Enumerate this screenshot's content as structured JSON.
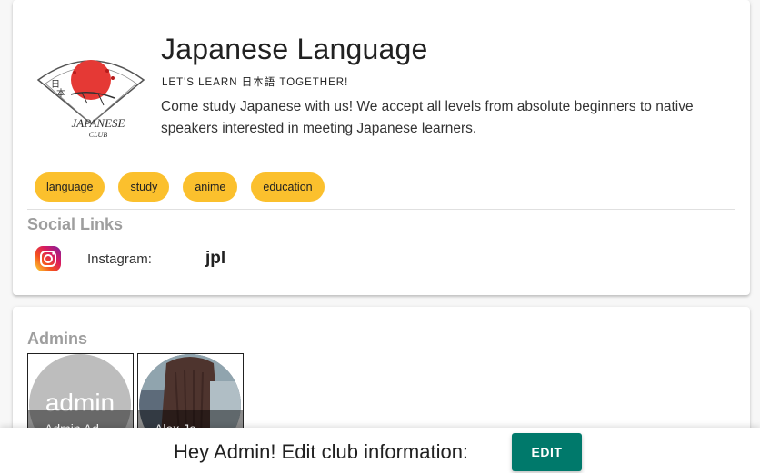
{
  "club": {
    "name": "Japanese Language",
    "tagline": "LET'S LEARN 日本語 TOGETHER!",
    "description": "Come study Japanese with us! We accept all levels from absolute beginners to native speakers interested in meeting Japanese learners.",
    "logo": {
      "icon": "japanese-club-fan-logo",
      "text_line1": "JAPANESE",
      "text_line2": "CLUB",
      "kanji": [
        "日",
        "本"
      ],
      "sun_color": "#e53935"
    },
    "tags": [
      "language",
      "study",
      "anime",
      "education"
    ],
    "tag_color": "#fbc02d"
  },
  "social": {
    "title": "Social Links",
    "links": [
      {
        "icon": "instagram-icon",
        "label": "Instagram:",
        "handle": "jpl"
      }
    ]
  },
  "admins": {
    "title": "Admins",
    "list": [
      {
        "avatar_text": "admin",
        "name": "Admin Ad"
      },
      {
        "avatar_text": "",
        "name": "Alex Jo"
      }
    ]
  },
  "bottom_bar": {
    "message": "Hey Admin! Edit club information:",
    "edit_label": "EDIT",
    "button_color": "#00796b"
  }
}
